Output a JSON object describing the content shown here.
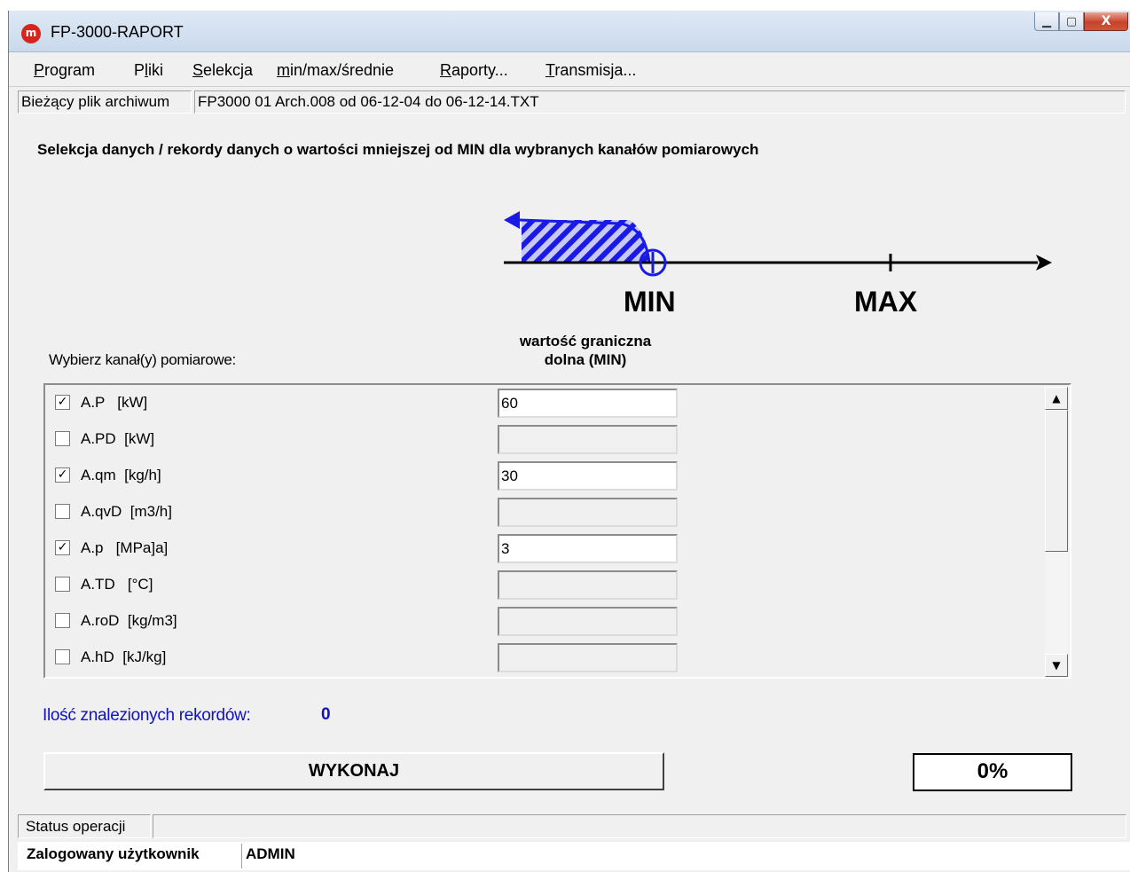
{
  "window": {
    "title": "FP-3000-RAPORT",
    "icon_letter": "m",
    "minimize_glyph": "▁",
    "maximize_glyph": "▢",
    "close_glyph": "X"
  },
  "menu": {
    "items": [
      {
        "ul": "P",
        "rest": "rogram"
      },
      {
        "pre": "P",
        "ul": "l",
        "rest": "iki"
      },
      {
        "ul": "S",
        "rest": "elekcja"
      },
      {
        "ul": "m",
        "rest": "in/max/średnie"
      },
      {
        "ul": "R",
        "rest": "aporty..."
      },
      {
        "ul": "T",
        "rest": "ransmisja..."
      }
    ]
  },
  "file": {
    "label": "Bieżący plik archiwum",
    "value": "FP3000 01 Arch.008 od 06-12-04 do 06-12-14.TXT"
  },
  "heading": "Selekcja danych / rekordy danych o wartości mniejszej od MIN dla wybranych kanałów pomiarowych",
  "diagram": {
    "min_label": "MIN",
    "max_label": "MAX",
    "accent_color": "#1a1ae6"
  },
  "column_header_line1": "wartość graniczna",
  "column_header_line2": "dolna (MIN)",
  "choose_label": "Wybierz kanał(y) pomiarowe:",
  "channels": [
    {
      "name": "A.P   [kW]",
      "checked": true,
      "value": "60"
    },
    {
      "name": "A.PD  [kW]",
      "checked": false,
      "value": ""
    },
    {
      "name": "A.qm  [kg/h]",
      "checked": true,
      "value": "30"
    },
    {
      "name": "A.qvD  [m3/h]",
      "checked": false,
      "value": ""
    },
    {
      "name": "A.p   [MPa]a]",
      "checked": true,
      "value": "3"
    },
    {
      "name": "A.TD   [°C]",
      "checked": false,
      "value": ""
    },
    {
      "name": "A.roD  [kg/m3]",
      "checked": false,
      "value": ""
    },
    {
      "name": "A.hD  [kJ/kg]",
      "checked": false,
      "value": ""
    }
  ],
  "checkmark_glyph": "✓",
  "scroll_up_glyph": "▲",
  "scroll_down_glyph": "▼",
  "records_label": "Ilość znalezionych rekordów:",
  "records_count": "0",
  "execute_button": "WYKONAJ",
  "progress": "0%",
  "status_label": "Status operacji",
  "status_value": "",
  "user_label": "Zalogowany użytkownik",
  "user_value": "ADMIN"
}
